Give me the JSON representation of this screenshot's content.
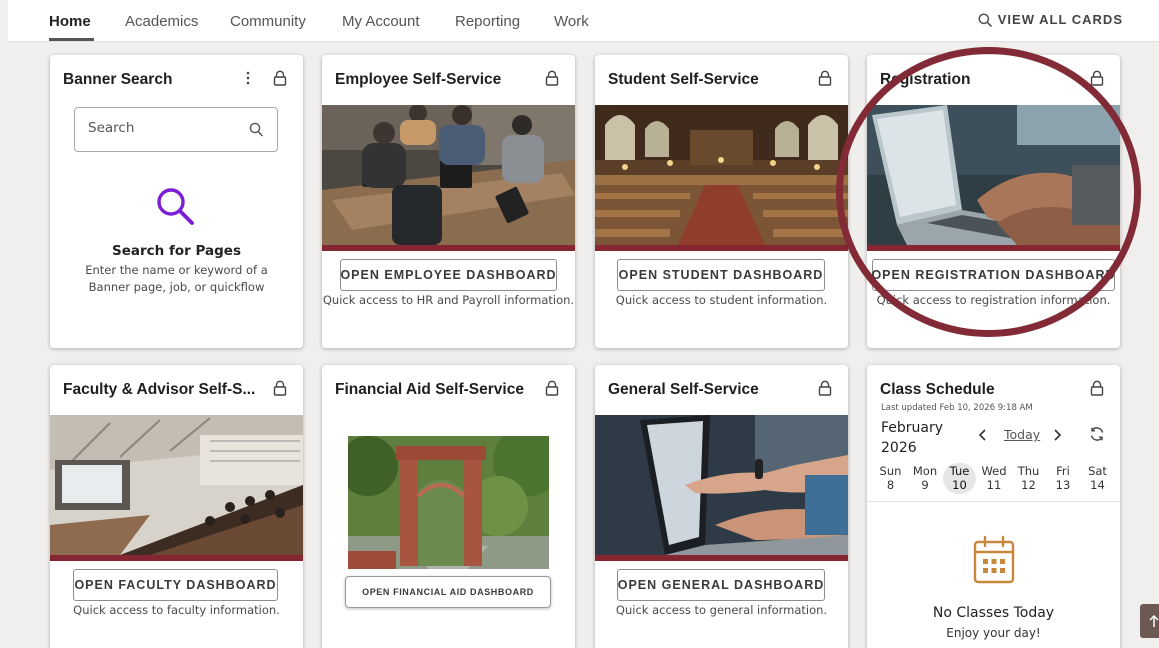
{
  "nav": {
    "tabs": [
      {
        "label": "Home",
        "active": true
      },
      {
        "label": "Academics"
      },
      {
        "label": "Community"
      },
      {
        "label": "My Account"
      },
      {
        "label": "Reporting"
      },
      {
        "label": "Work"
      }
    ],
    "view_all_label": "VIEW ALL CARDS"
  },
  "colors": {
    "accent": "#862633",
    "annotation": "#822a35",
    "search_icon": "#7a1fd6",
    "calendar_icon": "#c8883c"
  },
  "cards": {
    "banner_search": {
      "title": "Banner Search",
      "search_placeholder": "Search",
      "heading": "Search for Pages",
      "description": "Enter the name or keyword of a Banner page, job, or quickflow"
    },
    "employee": {
      "title": "Employee Self-Service",
      "button": "OPEN EMPLOYEE DASHBOARD",
      "description": "Quick access to HR and Payroll information."
    },
    "student": {
      "title": "Student Self-Service",
      "button": "OPEN STUDENT DASHBOARD",
      "description": "Quick access to student information."
    },
    "registration": {
      "title": "Registration",
      "button": "OPEN REGISTRATION DASHBOARD",
      "description": "Quick access to registration information."
    },
    "faculty": {
      "title": "Faculty & Advisor Self-S...",
      "button": "OPEN FACULTY DASHBOARD",
      "description": "Quick access to faculty information."
    },
    "financial_aid": {
      "title": "Financial Aid Self-Service",
      "button": "OPEN FINANCIAL AID DASHBOARD"
    },
    "general": {
      "title": "General Self-Service",
      "button": "OPEN GENERAL DASHBOARD",
      "description": "Quick access to general information."
    },
    "class_schedule": {
      "title": "Class Schedule",
      "last_updated": "Last updated Feb 10, 2026 9:18 AM",
      "month": "February",
      "year": "2026",
      "today_label": "Today",
      "days": [
        {
          "name": "Sun",
          "num": "8"
        },
        {
          "name": "Mon",
          "num": "9"
        },
        {
          "name": "Tue",
          "num": "10",
          "selected": true
        },
        {
          "name": "Wed",
          "num": "11"
        },
        {
          "name": "Thu",
          "num": "12"
        },
        {
          "name": "Fri",
          "num": "13"
        },
        {
          "name": "Sat",
          "num": "14"
        }
      ],
      "empty_title": "No Classes Today",
      "empty_sub": "Enjoy your day!"
    }
  },
  "icons": {
    "lock": "lock-icon",
    "kebab": "kebab-menu-icon",
    "search": "search-icon",
    "calendar": "calendar-icon",
    "refresh": "refresh-icon",
    "arrow_up": "arrow-up-icon"
  }
}
